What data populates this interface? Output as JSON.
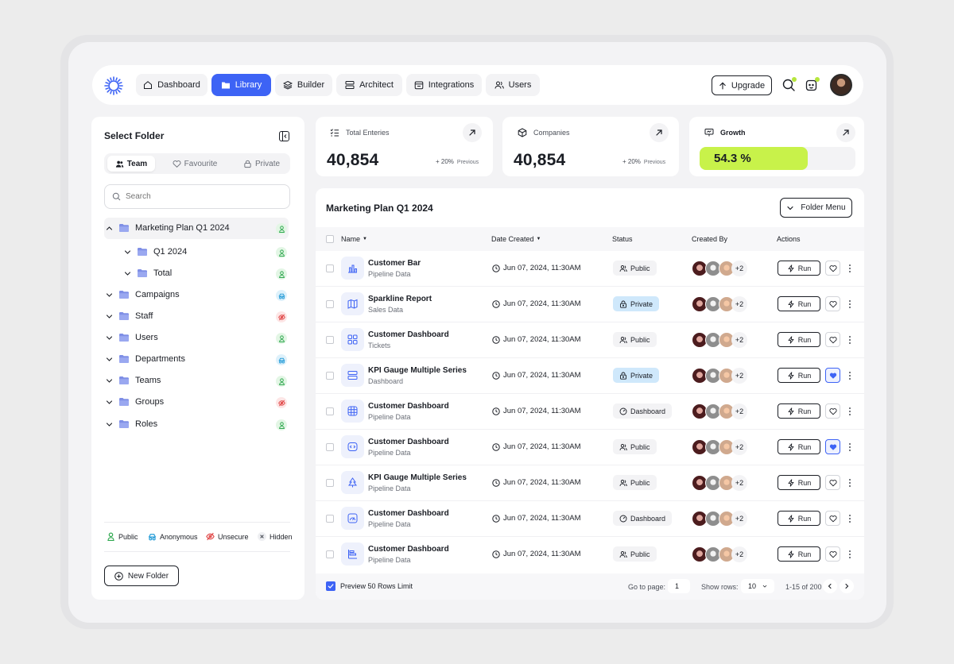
{
  "nav": {
    "tabs": [
      {
        "label": "Dashboard",
        "icon": "home-icon"
      },
      {
        "label": "Library",
        "icon": "folder-icon",
        "active": true
      },
      {
        "label": "Builder",
        "icon": "layers-icon"
      },
      {
        "label": "Architect",
        "icon": "server-icon"
      },
      {
        "label": "Integrations",
        "icon": "calendar-icon"
      },
      {
        "label": "Users",
        "icon": "users-icon"
      }
    ],
    "upgrade_label": "Upgrade"
  },
  "sidebar": {
    "title": "Select Folder",
    "segments": [
      {
        "label": "Team",
        "active": true
      },
      {
        "label": "Favourite"
      },
      {
        "label": "Private"
      }
    ],
    "search_placeholder": "Search",
    "tree": [
      {
        "label": "Marketing Plan Q1 2024",
        "badge": "public",
        "expanded": true
      },
      {
        "label": "Q1 2024",
        "badge": "public",
        "indent": true
      },
      {
        "label": "Total",
        "badge": "public",
        "indent": true
      },
      {
        "label": "Campaigns",
        "badge": "anonymous"
      },
      {
        "label": "Staff",
        "badge": "unsecure"
      },
      {
        "label": "Users",
        "badge": "public"
      },
      {
        "label": "Departments",
        "badge": "anonymous"
      },
      {
        "label": "Teams",
        "badge": "public"
      },
      {
        "label": "Groups",
        "badge": "unsecure"
      },
      {
        "label": "Roles",
        "badge": "public"
      }
    ],
    "legend": {
      "public": "Public",
      "anonymous": "Anonymous",
      "unsecure": "Unsecure",
      "hidden": "Hidden"
    },
    "new_folder_label": "New Folder"
  },
  "stats": {
    "total": {
      "label": "Total Enteries",
      "value": "40,854",
      "delta": "+ 20%",
      "delta_note": "Previous"
    },
    "companies": {
      "label": "Companies",
      "value": "40,854",
      "delta": "+ 20%",
      "delta_note": "Previous"
    },
    "growth": {
      "label": "Growth",
      "value": "54.3 %",
      "progress": 0.543
    }
  },
  "table": {
    "title": "Marketing Plan Q1 2024",
    "folder_menu_label": "Folder Menu",
    "headers": {
      "name": "Name",
      "date": "Date Created",
      "status": "Status",
      "created_by": "Created By",
      "actions": "Actions"
    },
    "run_label": "Run",
    "avatar_more": "+2",
    "rows": [
      {
        "title": "Customer Bar",
        "sub": "Pipeline Data",
        "date": "Jun 07, 2024, 11:30AM",
        "status": "Public",
        "icon": "bar-chart-icon",
        "fav": false
      },
      {
        "title": "Sparkline Report",
        "sub": "Sales Data",
        "date": "Jun 07, 2024, 11:30AM",
        "status": "Private",
        "icon": "map-icon",
        "fav": false
      },
      {
        "title": "Customer Dashboard",
        "sub": "Tickets",
        "date": "Jun 07, 2024, 11:30AM",
        "status": "Public",
        "icon": "grid-icon",
        "fav": false
      },
      {
        "title": "KPI Gauge Multiple Series",
        "sub": "Dashboard",
        "date": "Jun 07, 2024, 11:30AM",
        "status": "Private",
        "icon": "server-icon",
        "fav": true
      },
      {
        "title": "Customer Dashboard",
        "sub": "Pipeline Data",
        "date": "Jun 07, 2024, 11:30AM",
        "status": "Dashboard",
        "icon": "globe-icon",
        "fav": false
      },
      {
        "title": "Customer Dashboard",
        "sub": "Pipeline Data",
        "date": "Jun 07, 2024, 11:30AM",
        "status": "Public",
        "icon": "code-icon",
        "fav": true
      },
      {
        "title": "KPI Gauge Multiple Series",
        "sub": "Pipeline Data",
        "date": "Jun 07, 2024, 11:30AM",
        "status": "Public",
        "icon": "tree-icon",
        "fav": false
      },
      {
        "title": "Customer Dashboard",
        "sub": "Pipeline Data",
        "date": "Jun 07, 2024, 11:30AM",
        "status": "Dashboard",
        "icon": "gauge-icon",
        "fav": false
      },
      {
        "title": "Customer Dashboard",
        "sub": "Pipeline Data",
        "date": "Jun 07, 2024, 11:30AM",
        "status": "Public",
        "icon": "gantt-icon",
        "fav": false
      }
    ],
    "footer": {
      "preview_label": "Preview 50 Rows Limit",
      "goto_label": "Go to page:",
      "goto_value": "1",
      "rows_label": "Show rows:",
      "rows_value": "10",
      "range": "1-15 of 200"
    }
  },
  "colors": {
    "accent": "#3d63f5",
    "growth": "#c8f24a",
    "private_bg": "#cfe8fb"
  }
}
